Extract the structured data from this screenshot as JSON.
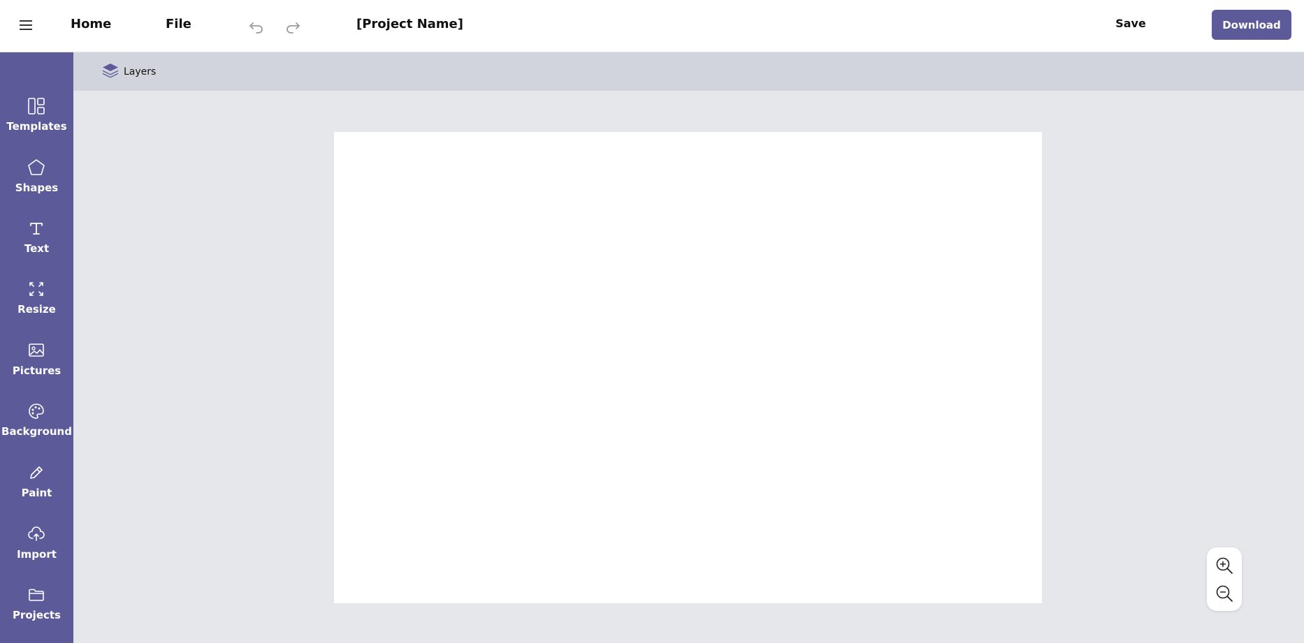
{
  "header": {
    "menu_icon": "hamburger-icon",
    "home_label": "Home",
    "file_label": "File",
    "undo_icon": "undo-icon",
    "redo_icon": "redo-icon",
    "project_name": "[Project Name]",
    "save_label": "Save",
    "download_label": "Download"
  },
  "sidebar": {
    "items": [
      {
        "label": "Templates",
        "icon": "templates-icon"
      },
      {
        "label": "Shapes",
        "icon": "pentagon-icon"
      },
      {
        "label": "Text",
        "icon": "text-icon"
      },
      {
        "label": "Resize",
        "icon": "resize-icon"
      },
      {
        "label": "Pictures",
        "icon": "image-icon"
      },
      {
        "label": "Background",
        "icon": "palette-icon"
      },
      {
        "label": "Paint",
        "icon": "pencil-icon"
      },
      {
        "label": "Import",
        "icon": "cloud-upload-icon"
      },
      {
        "label": "Projects",
        "icon": "folder-icon"
      }
    ]
  },
  "layers": {
    "label": "Layers",
    "icon": "layers-icon"
  },
  "zoom": {
    "in_icon": "zoom-in-icon",
    "out_icon": "zoom-out-icon"
  },
  "colors": {
    "brand": "#5c5a99",
    "layers_bar": "#d1d4dc",
    "workspace": "#e5e7eb",
    "artboard": "#ffffff"
  }
}
